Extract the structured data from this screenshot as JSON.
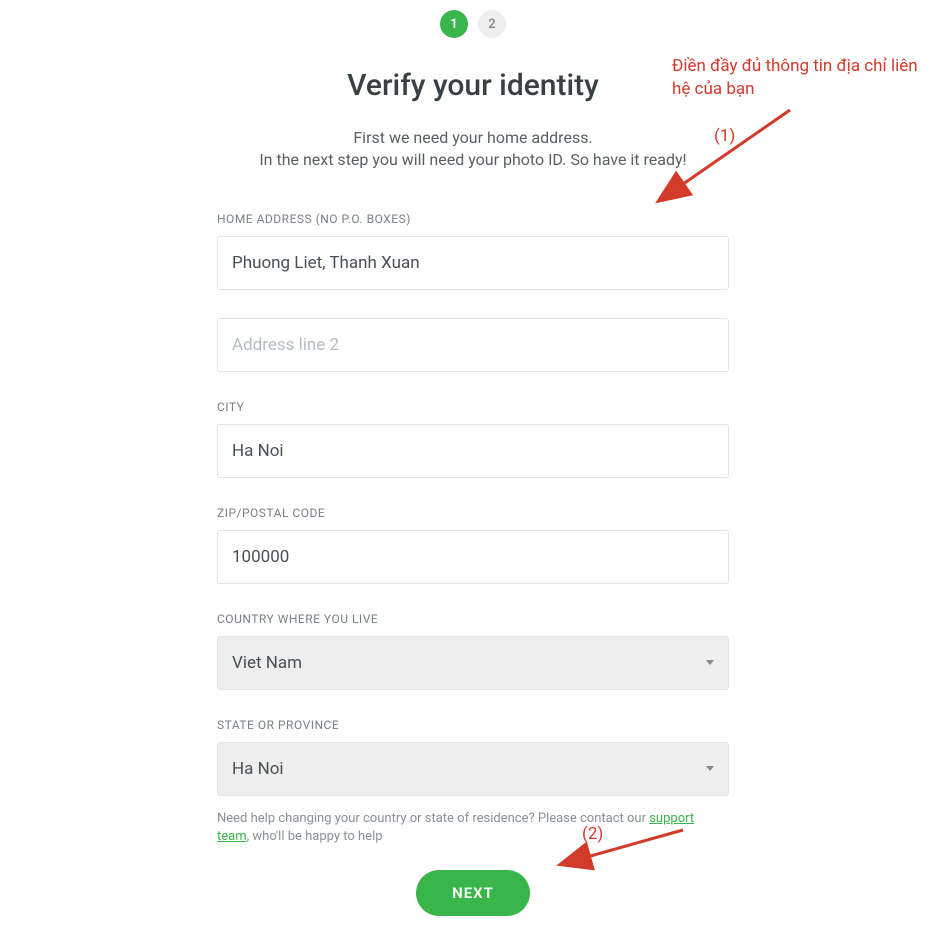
{
  "steps": {
    "step1": "1",
    "step2": "2"
  },
  "title": "Verify your identity",
  "description": {
    "line1": "First we need your home address.",
    "line2": "In the next step you will need your photo ID. So have it ready!"
  },
  "form": {
    "home_address": {
      "label": "HOME ADDRESS (NO P.O. BOXES)",
      "value": "Phuong Liet, Thanh Xuan"
    },
    "address_line2": {
      "placeholder": "Address line 2",
      "value": ""
    },
    "city": {
      "label": "CITY",
      "value": "Ha Noi"
    },
    "zip": {
      "label": "ZIP/POSTAL CODE",
      "value": "100000"
    },
    "country": {
      "label": "COUNTRY WHERE YOU LIVE",
      "value": "Viet Nam"
    },
    "state": {
      "label": "STATE OR PROVINCE",
      "value": "Ha Noi"
    }
  },
  "help": {
    "prefix": "Need help changing your country or state of residence? Please contact our ",
    "link": "support team",
    "suffix": ", who'll be happy to help"
  },
  "button": {
    "next": "NEXT"
  },
  "annotations": {
    "text": "Điền đầy đủ thông tin địa chỉ liên hệ của bạn",
    "num1": "(1)",
    "num2": "(2)"
  }
}
